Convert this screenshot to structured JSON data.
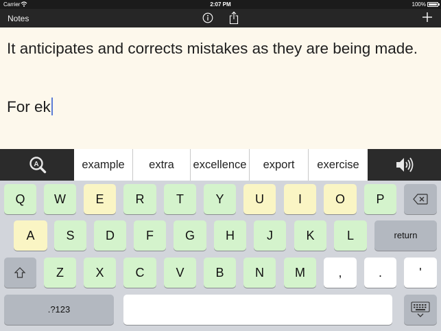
{
  "status_bar": {
    "carrier": "Carrier",
    "time": "2:07 PM",
    "battery": "100%"
  },
  "nav_bar": {
    "notes_label": "Notes"
  },
  "note": {
    "line1": "It anticipates and corrects mistakes as they are being made.",
    "line2": "For ek"
  },
  "suggestions": [
    "example",
    "extra",
    "excellence",
    "export",
    "exercise"
  ],
  "keyboard": {
    "row1": [
      "Q",
      "W",
      "E",
      "R",
      "T",
      "Y",
      "U",
      "I",
      "O",
      "P"
    ],
    "row2": [
      "A",
      "S",
      "D",
      "F",
      "G",
      "H",
      "J",
      "K",
      "L"
    ],
    "row3": [
      "Z",
      "X",
      "C",
      "V",
      "B",
      "N",
      "M",
      ",",
      ".",
      "'"
    ],
    "return_label": "return",
    "numbers_label": ".?123"
  },
  "colors": {
    "green_key": "#d4f3cc",
    "yellow_key": "#faf5c4",
    "paper": "#fdf8ec",
    "caret": "#5b7bd6"
  }
}
